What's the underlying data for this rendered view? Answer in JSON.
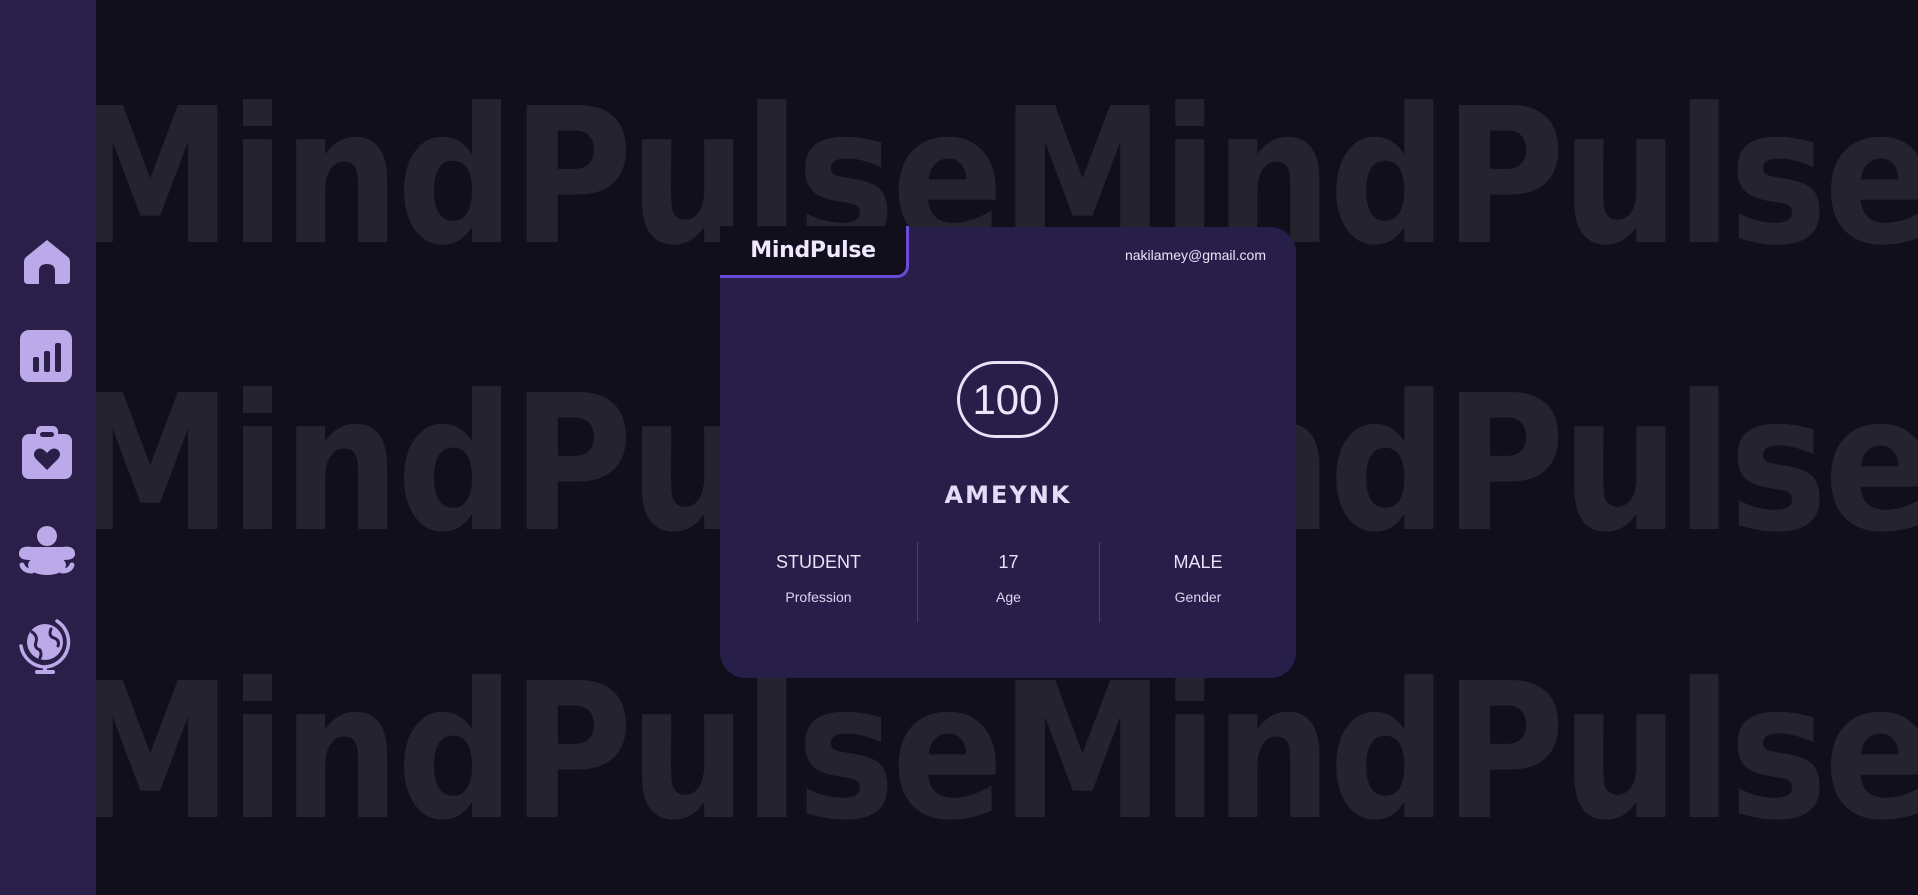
{
  "app": {
    "name": "MindPulse"
  },
  "watermark": {
    "row1": "MindPulseMindPulseMindPulse",
    "row2": "MindPulseMindPulseMindPulse",
    "row3": "MindPulseMindPulseMindPulse"
  },
  "sidebar": {
    "items": [
      {
        "icon": "home-icon"
      },
      {
        "icon": "bar-chart-icon"
      },
      {
        "icon": "clipboard-heart-icon"
      },
      {
        "icon": "meditation-icon"
      },
      {
        "icon": "globe-icon"
      }
    ]
  },
  "profile": {
    "brand": "MindPulse",
    "email": "nakilamey@gmail.com",
    "score": "100",
    "name": "AMEYNK",
    "stats": [
      {
        "value": "STUDENT",
        "label": "Profession"
      },
      {
        "value": "17",
        "label": "Age"
      },
      {
        "value": "MALE",
        "label": "Gender"
      }
    ]
  },
  "colors": {
    "background": "#120f1d",
    "sidebar": "#2a1f48",
    "card": "#281e4a",
    "accent": "#6a4bd9",
    "icon": "#bba9e9"
  }
}
